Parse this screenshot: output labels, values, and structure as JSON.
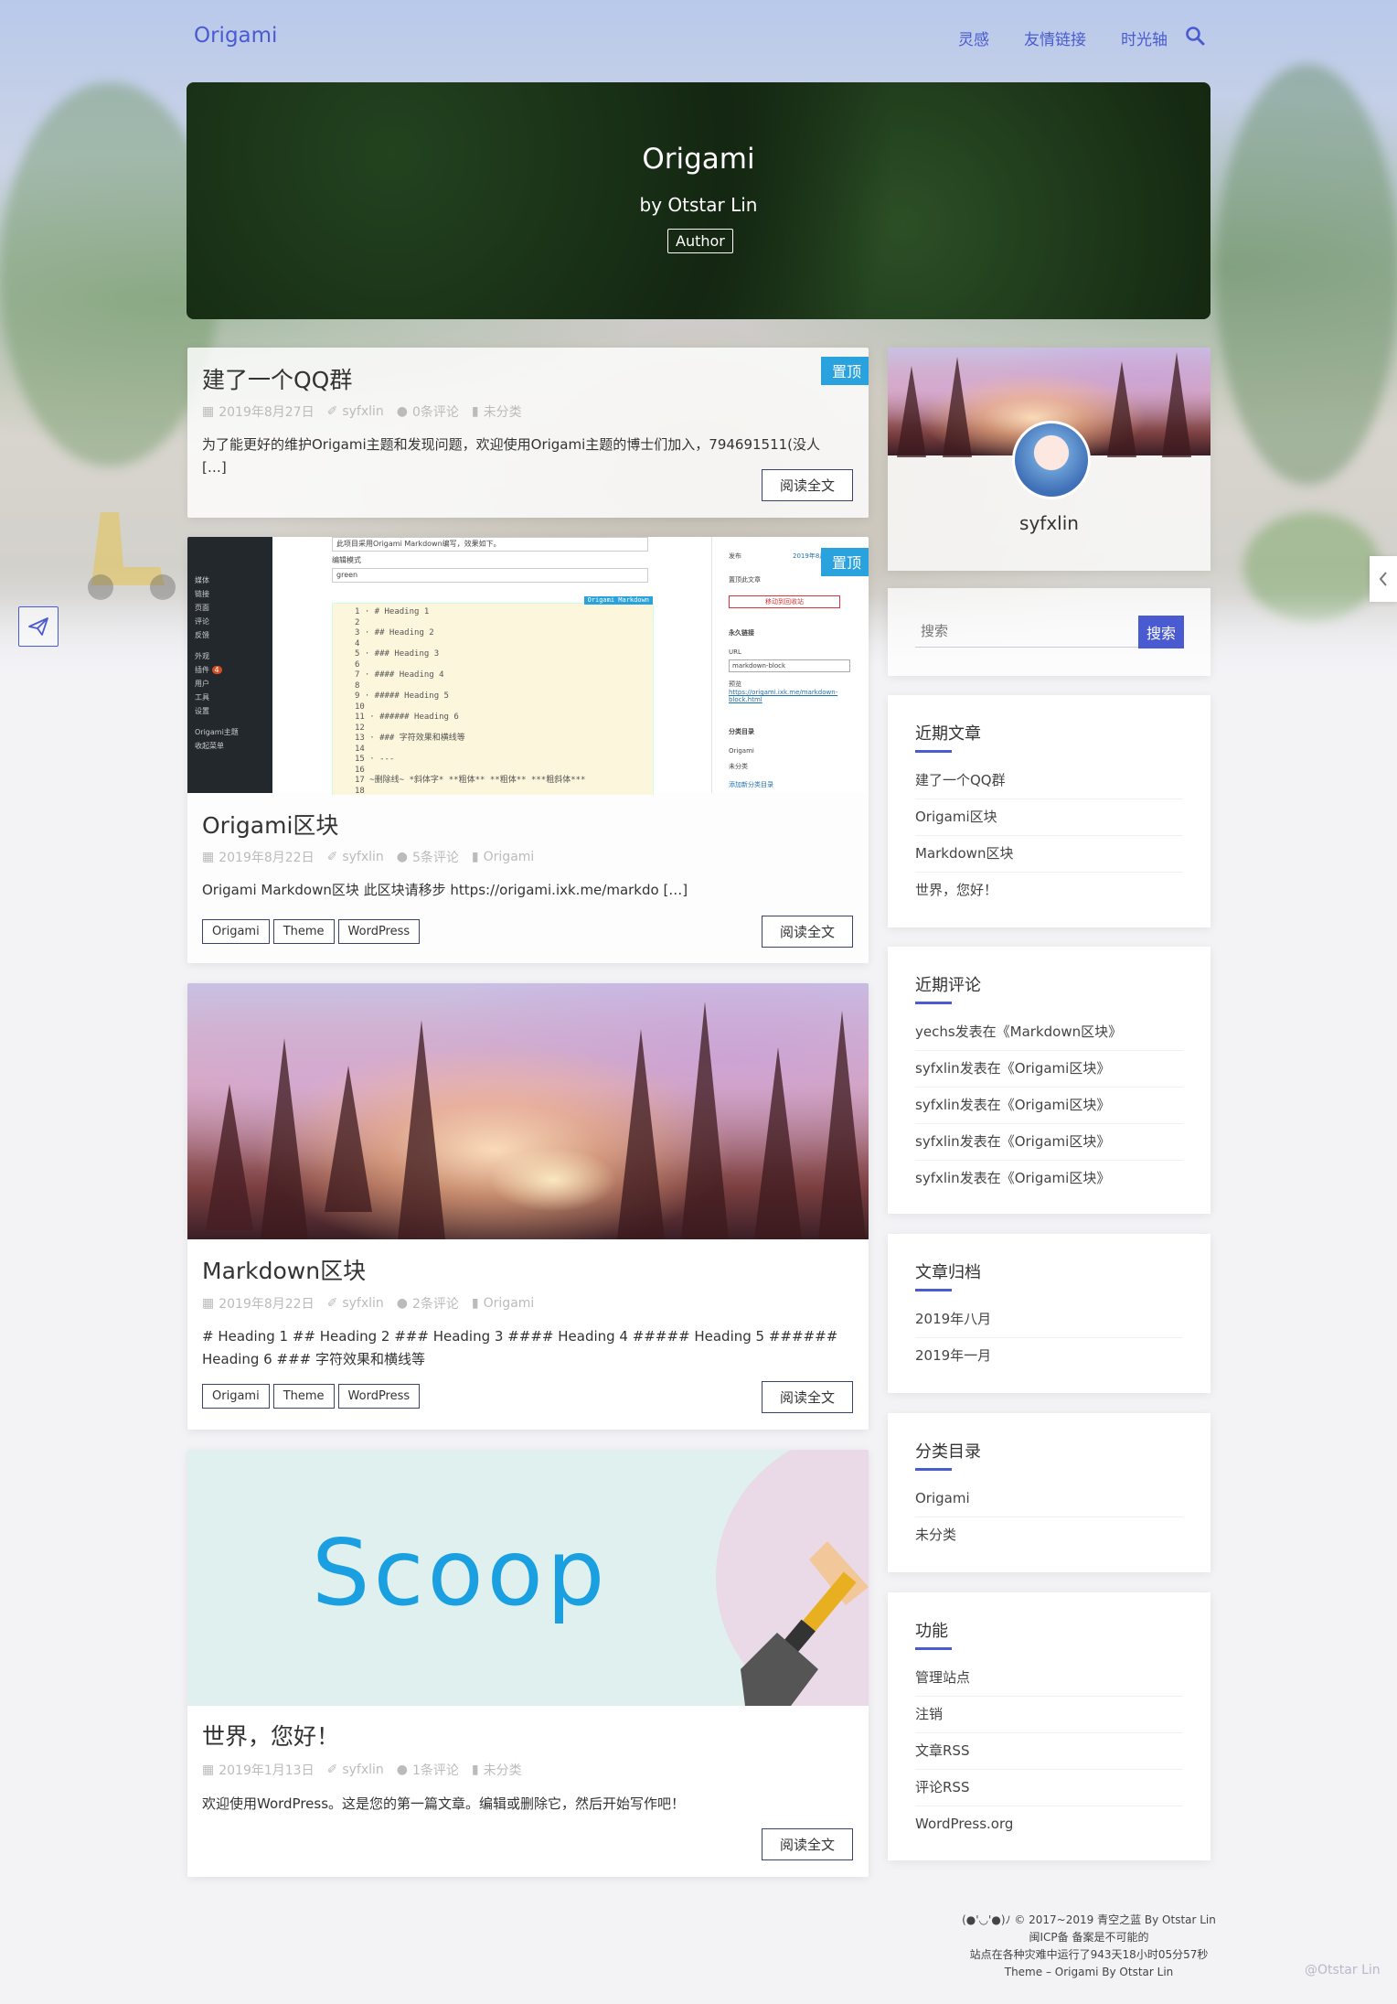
{
  "nav": {
    "brand": "Origami",
    "links": [
      "灵感",
      "友情链接",
      "时光轴"
    ]
  },
  "hero": {
    "title": "Origami",
    "subtitle": "by Otstar Lin",
    "badge": "Author"
  },
  "posts": [
    {
      "title": "建了一个QQ群",
      "pin": "置顶",
      "date": "2019年8月27日",
      "author": "syfxlin",
      "comments": "0条评论",
      "category": "未分类",
      "excerpt": "为了能更好的维护Origami主题和发现问题，欢迎使用Origami主题的博士们加入，794691511(没人 […]",
      "readmore": "阅读全文"
    },
    {
      "title": "Origami区块",
      "pin": "置顶",
      "date": "2019年8月22日",
      "author": "syfxlin",
      "comments": "5条评论",
      "category": "Origami",
      "excerpt": "Origami Markdown区块 此区块请移步 https://origami.ixk.me/markdo […]",
      "tags": [
        "Origami",
        "Theme",
        "WordPress"
      ],
      "readmore": "阅读全文",
      "thumb": {
        "top_text": "此项目采用Origami Markdown编写，效果如下。",
        "field_label": "编辑模式",
        "field_value": "green",
        "editor_label": "Origami Markdown",
        "side_menu": [
          "媒体",
          "链接",
          "页面",
          "评论",
          "反馈",
          "外观",
          "插件",
          "用户",
          "工具",
          "设置",
          "Origami主题",
          "收起菜单"
        ],
        "plugin_badge": "4",
        "code_lines": [
          "1 · # Heading 1",
          "2",
          "3 · ## Heading 2",
          "4",
          "5 · ### Heading 3",
          "6",
          "7 · #### Heading 4",
          "8",
          "9 · ##### Heading 5",
          "10",
          "11 · ###### Heading 6",
          "12",
          "13 · ### 字符效果和横线等",
          "14",
          "15 · ---",
          "16",
          "17 ~删除线~ *斜体字* **粗体** **粗体** ***粗斜体***",
          "18"
        ],
        "right_panel": [
          "发布",
          "2019年8月",
          "置顶此文章",
          "移动到回收站",
          "永久链接",
          "URL",
          "markdown-block",
          "预览",
          "https://origami.ixk.me/markdown-block.html",
          "分类目录",
          "Origami",
          "未分类",
          "添加新分类目录"
        ]
      }
    },
    {
      "title": "Markdown区块",
      "date": "2019年8月22日",
      "author": "syfxlin",
      "comments": "2条评论",
      "category": "Origami",
      "excerpt": "# Heading 1 ## Heading 2 ### Heading 3 #### Heading 4 ##### Heading 5 ###### Heading 6 ### 字符效果和横线等",
      "tags": [
        "Origami",
        "Theme",
        "WordPress"
      ],
      "readmore": "阅读全文"
    },
    {
      "title": "世界，您好！",
      "date": "2019年1月13日",
      "author": "syfxlin",
      "comments": "1条评论",
      "category": "未分类",
      "excerpt": "欢迎使用WordPress。这是您的第一篇文章。编辑或删除它，然后开始写作吧！",
      "readmore": "阅读全文",
      "image_text": "Scoop"
    }
  ],
  "sidebar": {
    "profile_name": "syfxlin",
    "search": {
      "placeholder": "搜索",
      "button": "搜索"
    },
    "recent_posts": {
      "title": "近期文章",
      "items": [
        "建了一个QQ群",
        "Origami区块",
        "Markdown区块",
        "世界，您好！"
      ]
    },
    "recent_comments": {
      "title": "近期评论",
      "items": [
        "yechs发表在《Markdown区块》",
        "syfxlin发表在《Origami区块》",
        "syfxlin发表在《Origami区块》",
        "syfxlin发表在《Origami区块》",
        "syfxlin发表在《Origami区块》"
      ]
    },
    "archives": {
      "title": "文章归档",
      "items": [
        "2019年八月",
        "2019年一月"
      ]
    },
    "categories": {
      "title": "分类目录",
      "items": [
        "Origami",
        "未分类"
      ]
    },
    "meta": {
      "title": "功能",
      "items": [
        "管理站点",
        "注销",
        "文章RSS",
        "评论RSS",
        "WordPress.org"
      ]
    }
  },
  "footer": {
    "line1": "(●'◡'●)ﾉ  © 2017~2019 青空之蓝 By Otstar Lin",
    "line2": "闽ICP备 备案是不可能的",
    "line3": "站点在各种灾难中运行了943天18小时05分57秒",
    "line4": "Theme – Origami By Otstar Lin",
    "credit": "@Otstar Lin"
  },
  "colors": {
    "accent": "#4a5ad1",
    "pin": "#2aa2dd",
    "scoop_text": "#1aa0e0",
    "scoop_bg": "#dff0ee"
  },
  "icons": [
    "search-icon",
    "calendar-icon",
    "author-icon",
    "comment-icon",
    "bookmark-icon",
    "paper-plane-icon",
    "chevron-left-icon"
  ]
}
